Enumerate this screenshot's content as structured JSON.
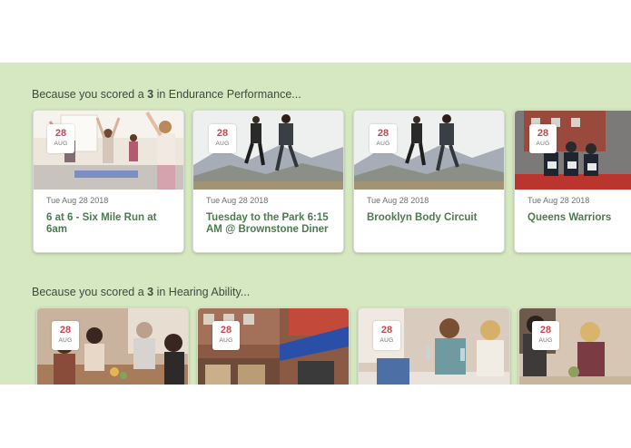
{
  "sections": [
    {
      "prefix": "Because you scored a ",
      "score": "3",
      "suffix": " in Endurance Performance...",
      "cards": [
        {
          "day": "28",
          "month": "AUG",
          "date": "Tue Aug 28 2018",
          "title": "6 at 6 - Six Mile Run at 6am",
          "image": "yoga class photo"
        },
        {
          "day": "28",
          "month": "AUG",
          "date": "Tue Aug 28 2018",
          "title": "Tuesday to the Park 6:15 AM @ Brownstone Diner",
          "image": "runners photo"
        },
        {
          "day": "28",
          "month": "AUG",
          "date": "Tue Aug 28 2018",
          "title": "Brooklyn Body Circuit",
          "image": "runners photo"
        },
        {
          "day": "28",
          "month": "AUG",
          "date": "Tue Aug 28 2018",
          "title": "Queens Warriors",
          "image": "group photo"
        }
      ]
    },
    {
      "prefix": "Because you scored a ",
      "score": "3",
      "suffix": " in Hearing Ability...",
      "cards": [
        {
          "day": "28",
          "month": "AUG",
          "image": "dinner party photo"
        },
        {
          "day": "28",
          "month": "AUG",
          "image": "restaurant storefront photo"
        },
        {
          "day": "28",
          "month": "AUG",
          "image": "friends toasting photo"
        },
        {
          "day": "28",
          "month": "AUG",
          "image": "friends dining photo"
        }
      ]
    }
  ],
  "colors": {
    "band_background": "#d5e8c1",
    "title_green": "#4d7a4f",
    "badge_day_red": "#c7474f"
  }
}
